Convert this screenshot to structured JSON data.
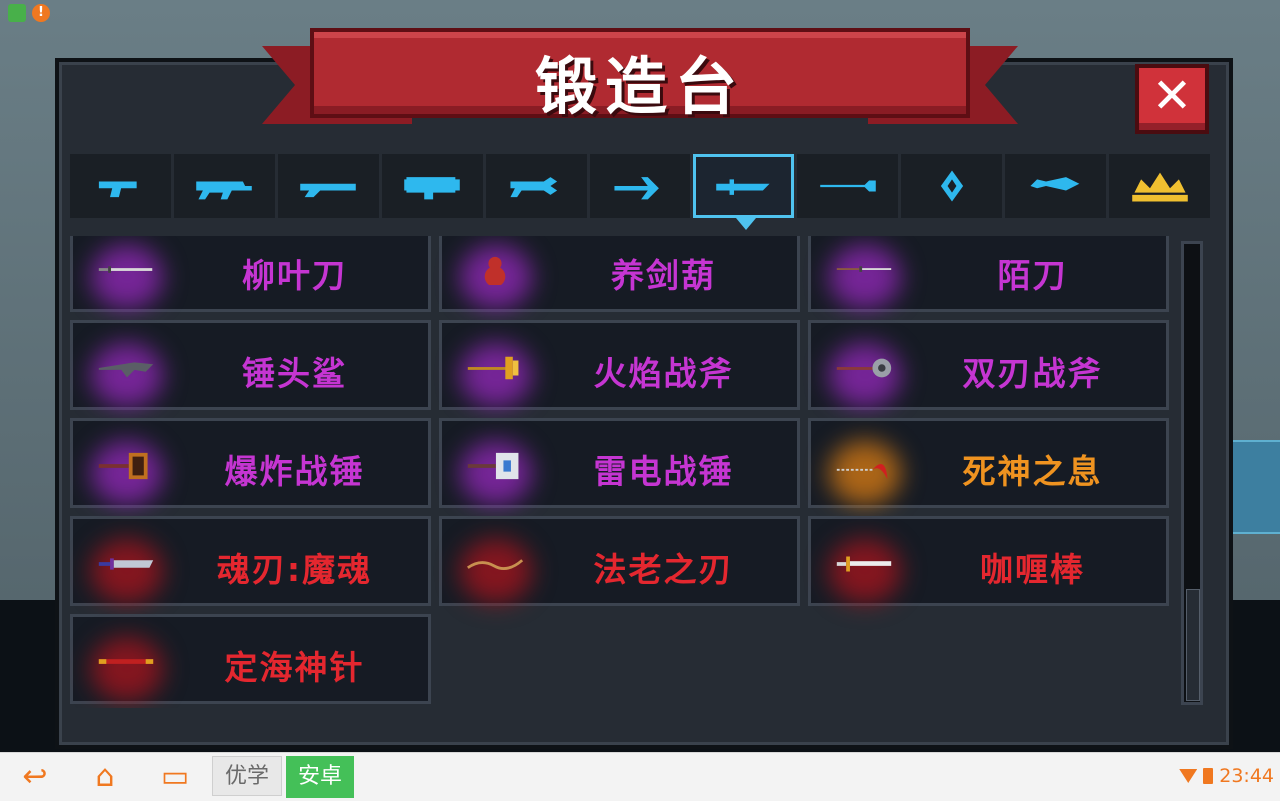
{
  "title": "锻造台",
  "close_label": "✕",
  "tabs": [
    {
      "id": "pistol",
      "selected": false,
      "color": "#2eb8ee"
    },
    {
      "id": "rifle",
      "selected": false,
      "color": "#2eb8ee"
    },
    {
      "id": "shotgun",
      "selected": false,
      "color": "#2eb8ee"
    },
    {
      "id": "launcher",
      "selected": false,
      "color": "#2eb8ee"
    },
    {
      "id": "laser",
      "selected": false,
      "color": "#2eb8ee"
    },
    {
      "id": "bow",
      "selected": false,
      "color": "#2eb8ee"
    },
    {
      "id": "melee",
      "selected": true,
      "color": "#2eb8ee"
    },
    {
      "id": "spear",
      "selected": false,
      "color": "#2eb8ee"
    },
    {
      "id": "throwable",
      "selected": false,
      "color": "#2eb8ee"
    },
    {
      "id": "other",
      "selected": false,
      "color": "#2eb8ee"
    },
    {
      "id": "crown",
      "selected": false,
      "color": "#f0c030"
    }
  ],
  "weapons": [
    {
      "name": "柳叶刀",
      "tier": "magenta",
      "glow": "purple",
      "icon": "short-blade-icon"
    },
    {
      "name": "养剑葫",
      "tier": "magenta",
      "glow": "purple",
      "icon": "gourd-icon"
    },
    {
      "name": "陌刀",
      "tier": "magenta",
      "glow": "purple",
      "icon": "long-blade-icon"
    },
    {
      "name": "锤头鲨",
      "tier": "magenta",
      "glow": "purple",
      "icon": "hammerhead-icon"
    },
    {
      "name": "火焰战斧",
      "tier": "magenta",
      "glow": "purple",
      "icon": "fire-axe-icon"
    },
    {
      "name": "双刃战斧",
      "tier": "magenta",
      "glow": "purple",
      "icon": "double-axe-icon"
    },
    {
      "name": "爆炸战锤",
      "tier": "magenta",
      "glow": "purple",
      "icon": "explosive-hammer-icon"
    },
    {
      "name": "雷电战锤",
      "tier": "magenta",
      "glow": "purple",
      "icon": "thunder-hammer-icon"
    },
    {
      "name": "死神之息",
      "tier": "orange",
      "glow": "orange",
      "icon": "scythe-icon"
    },
    {
      "name": "魂刃:魔魂",
      "tier": "red",
      "glow": "red",
      "icon": "soul-blade-icon"
    },
    {
      "name": "法老之刃",
      "tier": "red",
      "glow": "red",
      "icon": "pharaoh-blade-icon"
    },
    {
      "name": "咖喱棒",
      "tier": "red",
      "glow": "red",
      "icon": "excalibur-icon"
    },
    {
      "name": "定海神针",
      "tier": "red",
      "glow": "red",
      "icon": "golden-staff-icon"
    }
  ],
  "nav": {
    "back_icon": "↩",
    "home_icon": "⌂",
    "recent_icon": "▭",
    "brand_a": "优学",
    "brand_b": "安卓",
    "time": "23:44"
  },
  "status_icons": [
    "notification-app-icon",
    "warning-icon"
  ],
  "status_warning_glyph": "!"
}
